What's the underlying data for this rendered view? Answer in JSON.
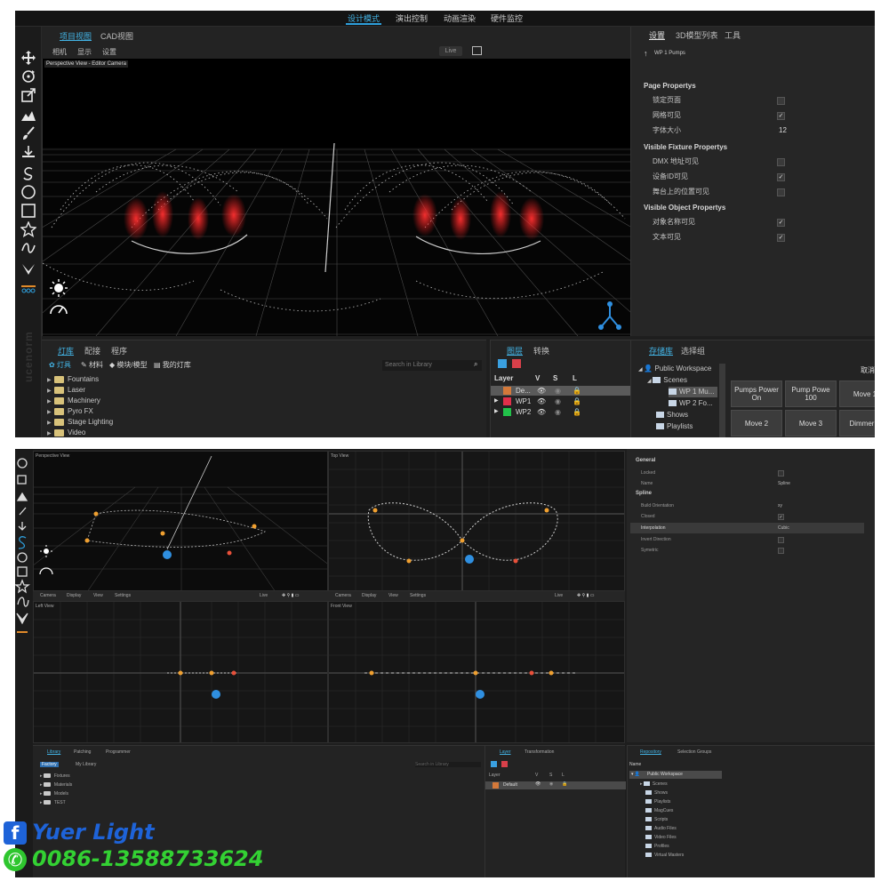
{
  "top_menu": [
    "设计模式",
    "演出控制",
    "动画渲染",
    "硬件监控"
  ],
  "viewport": {
    "tabs": [
      "项目视图",
      "CAD视图"
    ],
    "menu": [
      "相机",
      "显示",
      "设置"
    ],
    "live_label": "Live",
    "camera_label": "Perspective View - Editor Camera"
  },
  "properties": {
    "tabs": [
      "设置",
      "3D模型列表",
      "工具"
    ],
    "path": "WP 1 Pumps",
    "sections": [
      {
        "title": "Page Propertys",
        "rows": [
          {
            "label": "锁定页面",
            "type": "checkbox",
            "checked": false
          },
          {
            "label": "网格可见",
            "type": "checkbox",
            "checked": true
          },
          {
            "label": "字体大小",
            "type": "value",
            "value": "12"
          }
        ]
      },
      {
        "title": "Visible Fixture Propertys",
        "rows": [
          {
            "label": "DMX 地址可见",
            "type": "checkbox",
            "checked": false
          },
          {
            "label": "设备ID可见",
            "type": "checkbox",
            "checked": true
          },
          {
            "label": "舞台上的位置可见",
            "type": "checkbox",
            "checked": false
          }
        ]
      },
      {
        "title": "Visible Object Propertys",
        "rows": [
          {
            "label": "对象名称可见",
            "type": "checkbox",
            "checked": true
          },
          {
            "label": "文本可见",
            "type": "checkbox",
            "checked": true
          }
        ]
      }
    ]
  },
  "library": {
    "tabs": [
      "灯库",
      "配接",
      "程序"
    ],
    "subtabs": [
      "灯具",
      "材料",
      "模块/模型",
      "我的灯库"
    ],
    "search_placeholder": "Search in Library",
    "tree": [
      "Fountains",
      "Laser",
      "Machinery",
      "Pyro FX",
      "Stage Lighting",
      "Video"
    ]
  },
  "layers": {
    "tabs": [
      "图层",
      "转换"
    ],
    "headers": [
      "Layer",
      "V",
      "S",
      "L"
    ],
    "rows": [
      {
        "name": "De...",
        "color": "#d4793a",
        "selected": true
      },
      {
        "name": "WP1",
        "color": "#e0304a",
        "selected": false
      },
      {
        "name": "WP2",
        "color": "#22c24a",
        "selected": false
      }
    ]
  },
  "repository": {
    "tabs": [
      "存储库",
      "选择组"
    ],
    "tree": [
      "Public Workspace",
      "Scenes",
      "WP 1 Mu...",
      "WP 2 Fo...",
      "Shows",
      "Playlists"
    ],
    "cancel_label": "取消",
    "cue_buttons": [
      "Pumps Power On",
      "Pump Powe 100",
      "Move 1",
      "Move 2",
      "Move 3",
      "Dimmer F"
    ]
  },
  "shot2": {
    "views": [
      "Perspective View",
      "Top View",
      "Left View",
      "Front View"
    ],
    "view_menu": [
      "Camera",
      "Display",
      "View",
      "Settings"
    ],
    "live_label": "Live",
    "props": {
      "sections": [
        {
          "title": "General",
          "rows": [
            {
              "label": "Locked",
              "type": "checkbox",
              "checked": false
            },
            {
              "label": "Name",
              "type": "value",
              "value": "Spline"
            }
          ]
        },
        {
          "title": "Spline",
          "rows": [
            {
              "label": "Build Orientation",
              "type": "value",
              "value": "xy"
            },
            {
              "label": "Closed",
              "type": "checkbox",
              "checked": true
            },
            {
              "label": "Interpolation",
              "type": "value",
              "value": "Cubic",
              "selected": true
            },
            {
              "label": "Invert Direction",
              "type": "checkbox",
              "checked": false
            },
            {
              "label": "Symetric",
              "type": "checkbox",
              "checked": false
            }
          ]
        }
      ]
    },
    "library_tabs": [
      "Library",
      "Patching",
      "Programmer"
    ],
    "library_subtabs": [
      "Factory",
      "My Library"
    ],
    "library_search": "Search in Library",
    "library_tree": [
      "Fixtures",
      "Materials",
      "Models",
      "TEST"
    ],
    "layer_tabs": [
      "Layer",
      "Transformation"
    ],
    "layer_headers": [
      "Layer",
      "V",
      "S",
      "L"
    ],
    "layer_row": "Default",
    "repo_tabs": [
      "Repository",
      "Selection Groups"
    ],
    "repo_header": "Name",
    "repo_tree": [
      "Public Workspace",
      "Scenes",
      "Shows",
      "Playlists",
      "MagCues",
      "Scripts",
      "Audio Files",
      "Video Files",
      "Profiles",
      "Virtual Masters"
    ]
  },
  "contact": {
    "name": "Yuer Light",
    "phone": "0086-13588733624"
  },
  "colors": {
    "accent": "#43b4e6",
    "fountain_red": "#e2232a",
    "node_orange": "#f0a030",
    "node_blue": "#2f8fe0"
  }
}
